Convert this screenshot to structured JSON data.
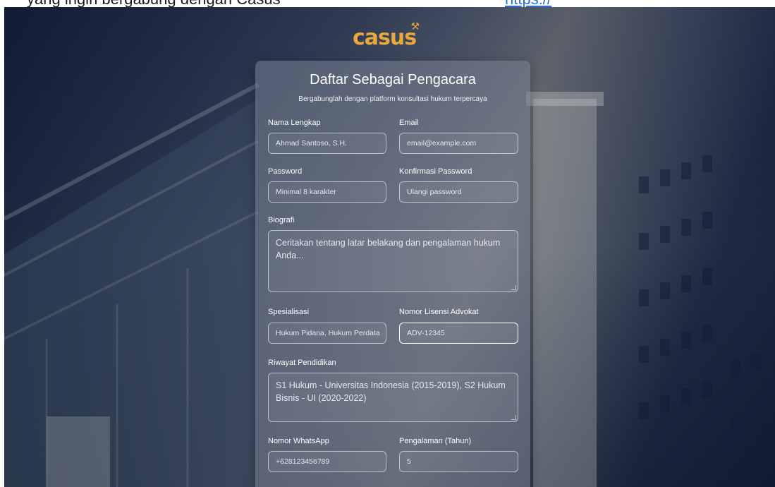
{
  "card": {
    "title": "Daftar Sebagai Pengacara",
    "subtitle": "Bergabunglah dengan platform konsultasi hukum terpercaya"
  },
  "form": {
    "nama": {
      "label": "Nama Lengkap",
      "placeholder": "Ahmad Santoso, S.H."
    },
    "email": {
      "label": "Email",
      "placeholder": "email@example.com"
    },
    "password": {
      "label": "Password",
      "placeholder": "Minimal 8 karakter"
    },
    "konfirmasi": {
      "label": "Konfirmasi Password",
      "placeholder": "Ulangi password"
    },
    "biografi": {
      "label": "Biografi",
      "placeholder": "Ceritakan tentang latar belakang dan pengalaman hukum Anda..."
    },
    "spesialisasi": {
      "label": "Spesialisasi",
      "placeholder": "Hukum Pidana, Hukum Perdata"
    },
    "lisensi": {
      "label": "Nomor Lisensi Advokat",
      "placeholder": "ADV-12345"
    },
    "pendidikan": {
      "label": "Riwayat Pendidikan",
      "placeholder": "S1 Hukum - Universitas Indonesia (2015-2019), S2 Hukum Bisnis - UI (2020-2022)"
    },
    "whatsapp": {
      "label": "Nomor WhatsApp",
      "placeholder": "+628123456789"
    },
    "pengalaman": {
      "label": "Pengalaman (Tahun)",
      "placeholder": "5"
    }
  },
  "icons": {
    "logo_mark": "hammer-icon"
  },
  "colors": {
    "logo": "#e8a93a",
    "card_bg": "rgba(120,130,145,0.55)",
    "text": "#ffffff"
  }
}
